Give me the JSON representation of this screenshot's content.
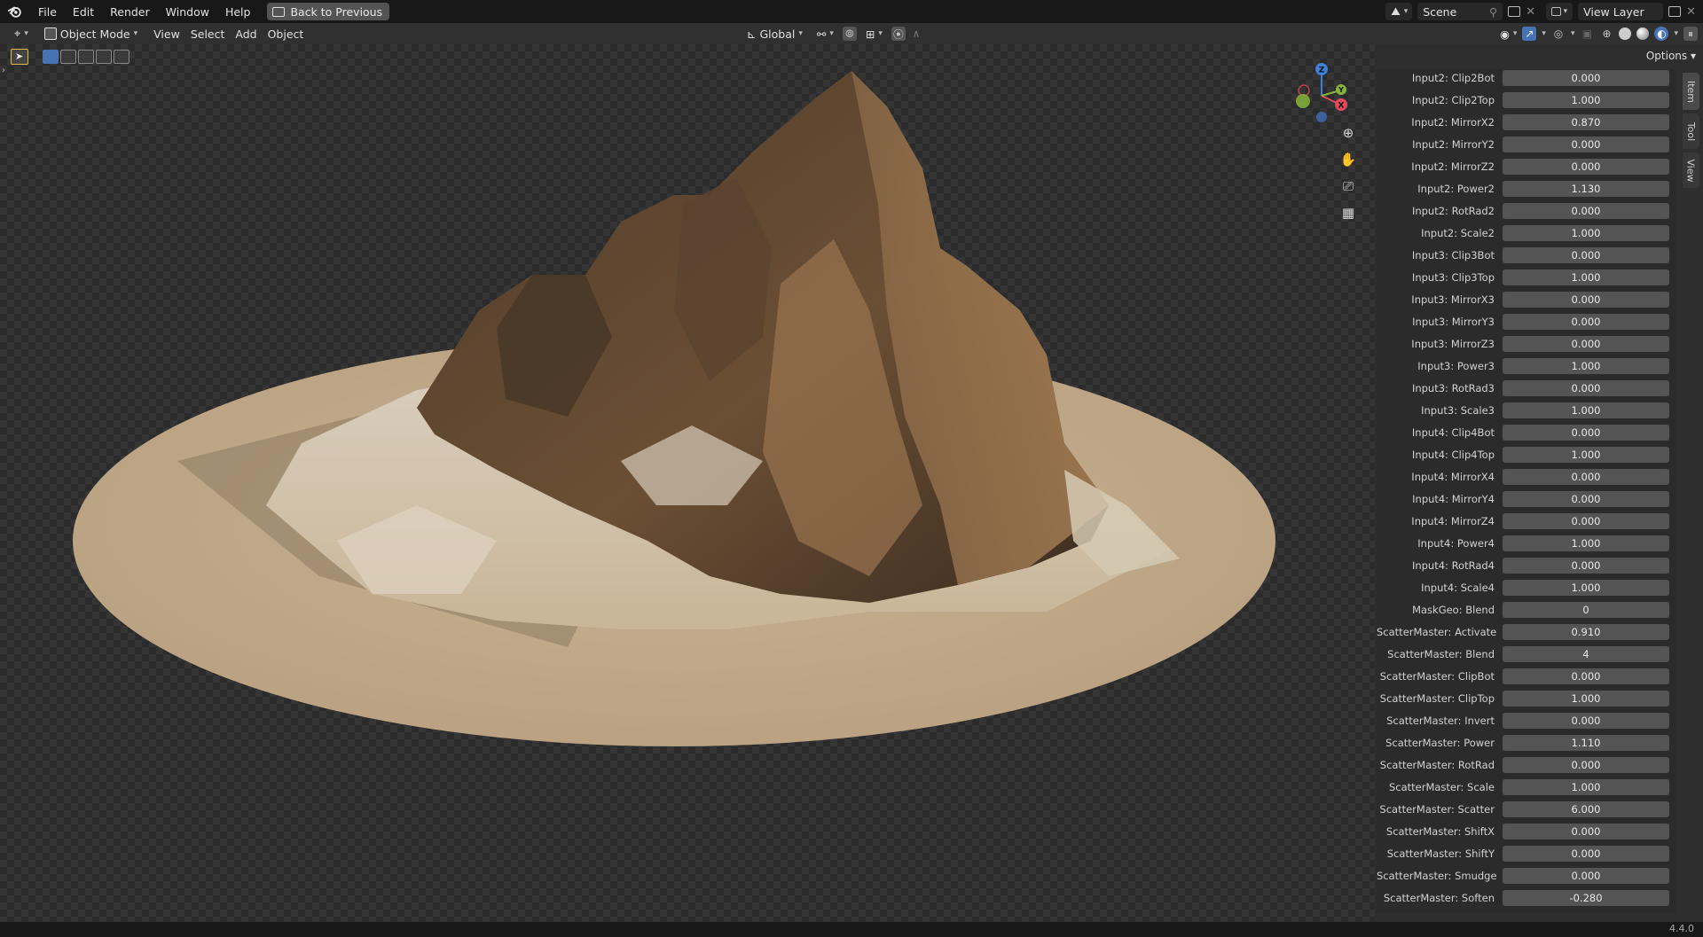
{
  "topbar": {
    "menu": [
      "File",
      "Edit",
      "Render",
      "Window",
      "Help"
    ],
    "back_button": "Back to Previous",
    "scene": "Scene",
    "view_layer": "View Layer"
  },
  "viewport_header": {
    "mode": "Object Mode",
    "menu": [
      "View",
      "Select",
      "Add",
      "Object"
    ],
    "orientation": "Global"
  },
  "npanel": {
    "options_label": "Options",
    "tabs": [
      "Item",
      "Tool",
      "View"
    ],
    "active_tab": "Item",
    "properties": [
      {
        "label": "Input2: Clip2Bot",
        "value": "0.000"
      },
      {
        "label": "Input2: Clip2Top",
        "value": "1.000"
      },
      {
        "label": "Input2: MirrorX2",
        "value": "0.870"
      },
      {
        "label": "Input2: MirrorY2",
        "value": "0.000"
      },
      {
        "label": "Input2: MirrorZ2",
        "value": "0.000"
      },
      {
        "label": "Input2: Power2",
        "value": "1.130"
      },
      {
        "label": "Input2: RotRad2",
        "value": "0.000"
      },
      {
        "label": "Input2: Scale2",
        "value": "1.000"
      },
      {
        "label": "Input3: Clip3Bot",
        "value": "0.000"
      },
      {
        "label": "Input3: Clip3Top",
        "value": "1.000"
      },
      {
        "label": "Input3: MirrorX3",
        "value": "0.000"
      },
      {
        "label": "Input3: MirrorY3",
        "value": "0.000"
      },
      {
        "label": "Input3: MirrorZ3",
        "value": "0.000"
      },
      {
        "label": "Input3: Power3",
        "value": "1.000"
      },
      {
        "label": "Input3: RotRad3",
        "value": "0.000"
      },
      {
        "label": "Input3: Scale3",
        "value": "1.000"
      },
      {
        "label": "Input4: Clip4Bot",
        "value": "0.000"
      },
      {
        "label": "Input4: Clip4Top",
        "value": "1.000"
      },
      {
        "label": "Input4: MirrorX4",
        "value": "0.000"
      },
      {
        "label": "Input4: MirrorY4",
        "value": "0.000"
      },
      {
        "label": "Input4: MirrorZ4",
        "value": "0.000"
      },
      {
        "label": "Input4: Power4",
        "value": "1.000"
      },
      {
        "label": "Input4: RotRad4",
        "value": "0.000"
      },
      {
        "label": "Input4: Scale4",
        "value": "1.000"
      },
      {
        "label": "MaskGeo: Blend",
        "value": "0"
      },
      {
        "label": "ScatterMaster: Activate",
        "value": "0.910"
      },
      {
        "label": "ScatterMaster: Blend",
        "value": "4"
      },
      {
        "label": "ScatterMaster: ClipBot",
        "value": "0.000"
      },
      {
        "label": "ScatterMaster: ClipTop",
        "value": "1.000"
      },
      {
        "label": "ScatterMaster: Invert",
        "value": "0.000"
      },
      {
        "label": "ScatterMaster: Power",
        "value": "1.110"
      },
      {
        "label": "ScatterMaster: RotRad",
        "value": "0.000"
      },
      {
        "label": "ScatterMaster: Scale",
        "value": "1.000"
      },
      {
        "label": "ScatterMaster: Scatter",
        "value": "6.000"
      },
      {
        "label": "ScatterMaster: ShiftX",
        "value": "0.000"
      },
      {
        "label": "ScatterMaster: ShiftY",
        "value": "0.000"
      },
      {
        "label": "ScatterMaster: Smudge",
        "value": "0.000"
      },
      {
        "label": "ScatterMaster: Soften",
        "value": "-0.280"
      }
    ]
  },
  "gizmo": {
    "x": "X",
    "y": "Y",
    "z": "Z"
  },
  "status": {
    "version": "4.4.0"
  },
  "colors": {
    "accent": "#4772b3",
    "axis_x": "#e04a5a",
    "axis_y": "#86b43a",
    "axis_z": "#3e7fd8"
  }
}
